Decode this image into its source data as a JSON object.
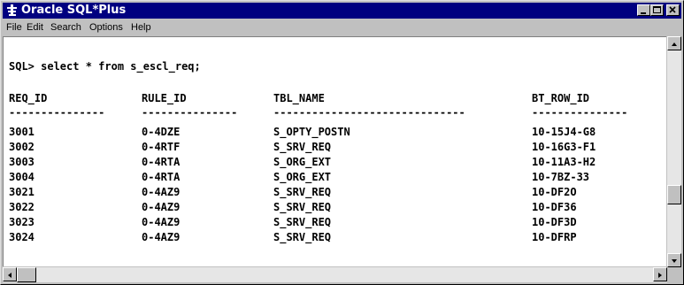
{
  "window": {
    "title": "Oracle SQL*Plus"
  },
  "menu": {
    "items": [
      "File",
      "Edit",
      "Search",
      "Options",
      "Help"
    ]
  },
  "console": {
    "command": "SQL> select * from s_escl_req;",
    "columns": [
      "REQ_ID",
      "RULE_ID",
      "TBL_NAME",
      "BT_ROW_ID"
    ],
    "separators": [
      "---------------",
      "---------------",
      "------------------------------",
      "---------------"
    ],
    "rows": [
      [
        "3001",
        "0-4DZE",
        "S_OPTY_POSTN",
        "10-15J4-G8"
      ],
      [
        "3002",
        "0-4RTF",
        "S_SRV_REQ",
        "10-16G3-F1"
      ],
      [
        "3003",
        "0-4RTA",
        "S_ORG_EXT",
        "10-11A3-H2"
      ],
      [
        "3004",
        "0-4RTA",
        "S_ORG_EXT",
        "10-7BZ-33"
      ],
      [
        "3021",
        "0-4AZ9",
        "S_SRV_REQ",
        "10-DF2O"
      ],
      [
        "3022",
        "0-4AZ9",
        "S_SRV_REQ",
        "10-DF36"
      ],
      [
        "3023",
        "0-4AZ9",
        "S_SRV_REQ",
        "10-DF3D"
      ],
      [
        "3024",
        "0-4AZ9",
        "S_SRV_REQ",
        "10-DFRP"
      ]
    ]
  },
  "icons": {
    "app": "oracle-sqlplus-icon",
    "minimize": "minimize-icon",
    "maximize": "maximize-icon",
    "close": "close-icon",
    "scroll_up": "arrow-up-icon",
    "scroll_down": "arrow-down-icon",
    "scroll_left": "arrow-left-icon",
    "scroll_right": "arrow-right-icon"
  },
  "colors": {
    "titlebar": "#000080",
    "chrome": "#c0c0c0",
    "console_bg": "#ffffff",
    "text": "#000000"
  }
}
